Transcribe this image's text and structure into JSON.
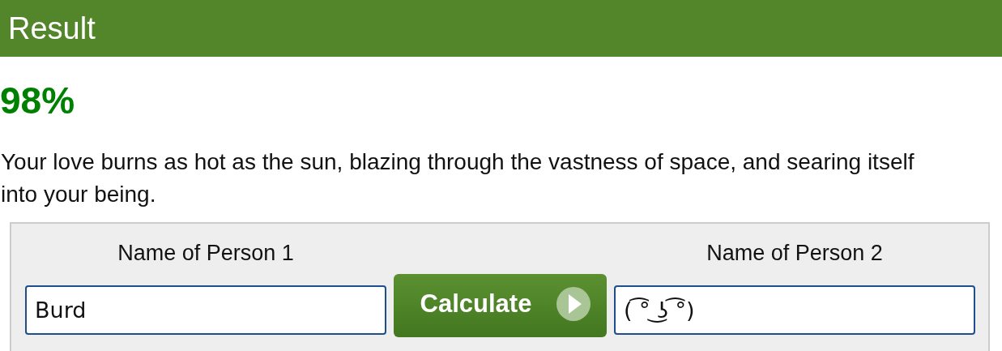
{
  "header": {
    "title": "Result"
  },
  "result": {
    "percent": "98%",
    "message": "Your love burns as hot as the sun, blazing through the vastness of space, and searing itself into your being."
  },
  "form": {
    "label_1": "Name of Person 1",
    "label_2": "Name of Person 2",
    "name_1": "Burd",
    "name_2": "( ͡° ͜ʖ ͡°)",
    "button": "Calculate"
  }
}
